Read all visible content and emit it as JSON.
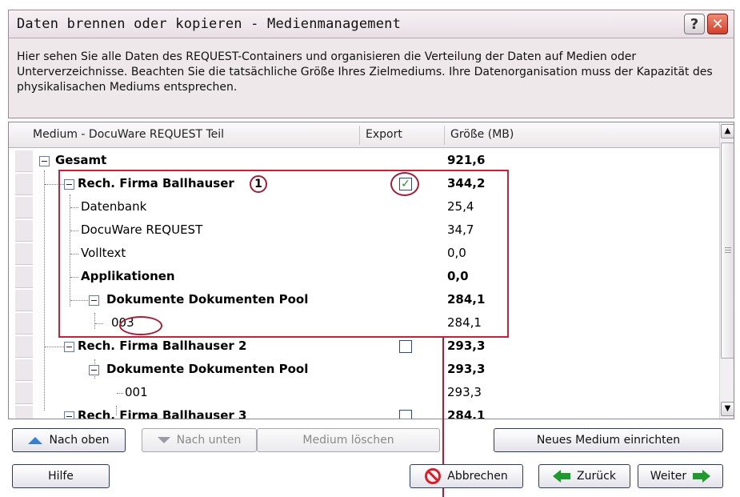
{
  "window": {
    "title": "Daten brennen oder kopieren - Medienmanagement",
    "help_label": "?",
    "close_label": "✕"
  },
  "info": {
    "text": "Hier sehen Sie alle Daten des REQUEST-Containers und organisieren die Verteilung der Daten auf  Medien oder Unterverzeichnisse. Beachten Sie die tatsächliche Größe Ihres Zielmediums. Ihre Datenorganisation muss der Kapazität des physikalisachen Mediums entsprechen."
  },
  "tree": {
    "columns": {
      "medium": "Medium - DocuWare REQUEST Teil",
      "export": "Export",
      "size": "Größe (MB)"
    },
    "rows": [
      {
        "label": "Gesamt",
        "size": "921,6",
        "bold": true
      },
      {
        "label": "Rech. Firma Ballhauser",
        "size": "344,2",
        "bold": true,
        "export": "checked"
      },
      {
        "label": "Datenbank",
        "size": "25,4",
        "bold": false
      },
      {
        "label": "DocuWare REQUEST",
        "size": "34,7",
        "bold": false
      },
      {
        "label": "Volltext",
        "size": "0,0",
        "bold": false
      },
      {
        "label": "Applikationen",
        "size": "0,0",
        "bold": true
      },
      {
        "label": "Dokumente Dokumenten Pool",
        "size": "284,1",
        "bold": true
      },
      {
        "label": "003",
        "size": "284,1",
        "bold": false
      },
      {
        "label": "Rech. Firma Ballhauser  2",
        "size": "293,3",
        "bold": true,
        "export": "unchecked"
      },
      {
        "label": "Dokumente Dokumenten Pool",
        "size": "293,3",
        "bold": true
      },
      {
        "label": "001",
        "size": "293,3",
        "bold": false
      },
      {
        "label": "Rech. Firma Ballhauser  3",
        "size": "284,1",
        "bold": true,
        "export": "unchecked"
      }
    ],
    "annotation_number": "1"
  },
  "buttons": {
    "up": "Nach oben",
    "down": "Nach unten",
    "delete_medium": "Medium löschen",
    "new_medium": "Neues Medium einrichten",
    "help": "Hilfe",
    "cancel": "Abbrechen",
    "back": "Zurück",
    "next": "Weiter"
  },
  "colors": {
    "annotation_red": "#c0243c",
    "check_green": "#1f8a2f",
    "arrow_blue": "#3a7fcf"
  }
}
